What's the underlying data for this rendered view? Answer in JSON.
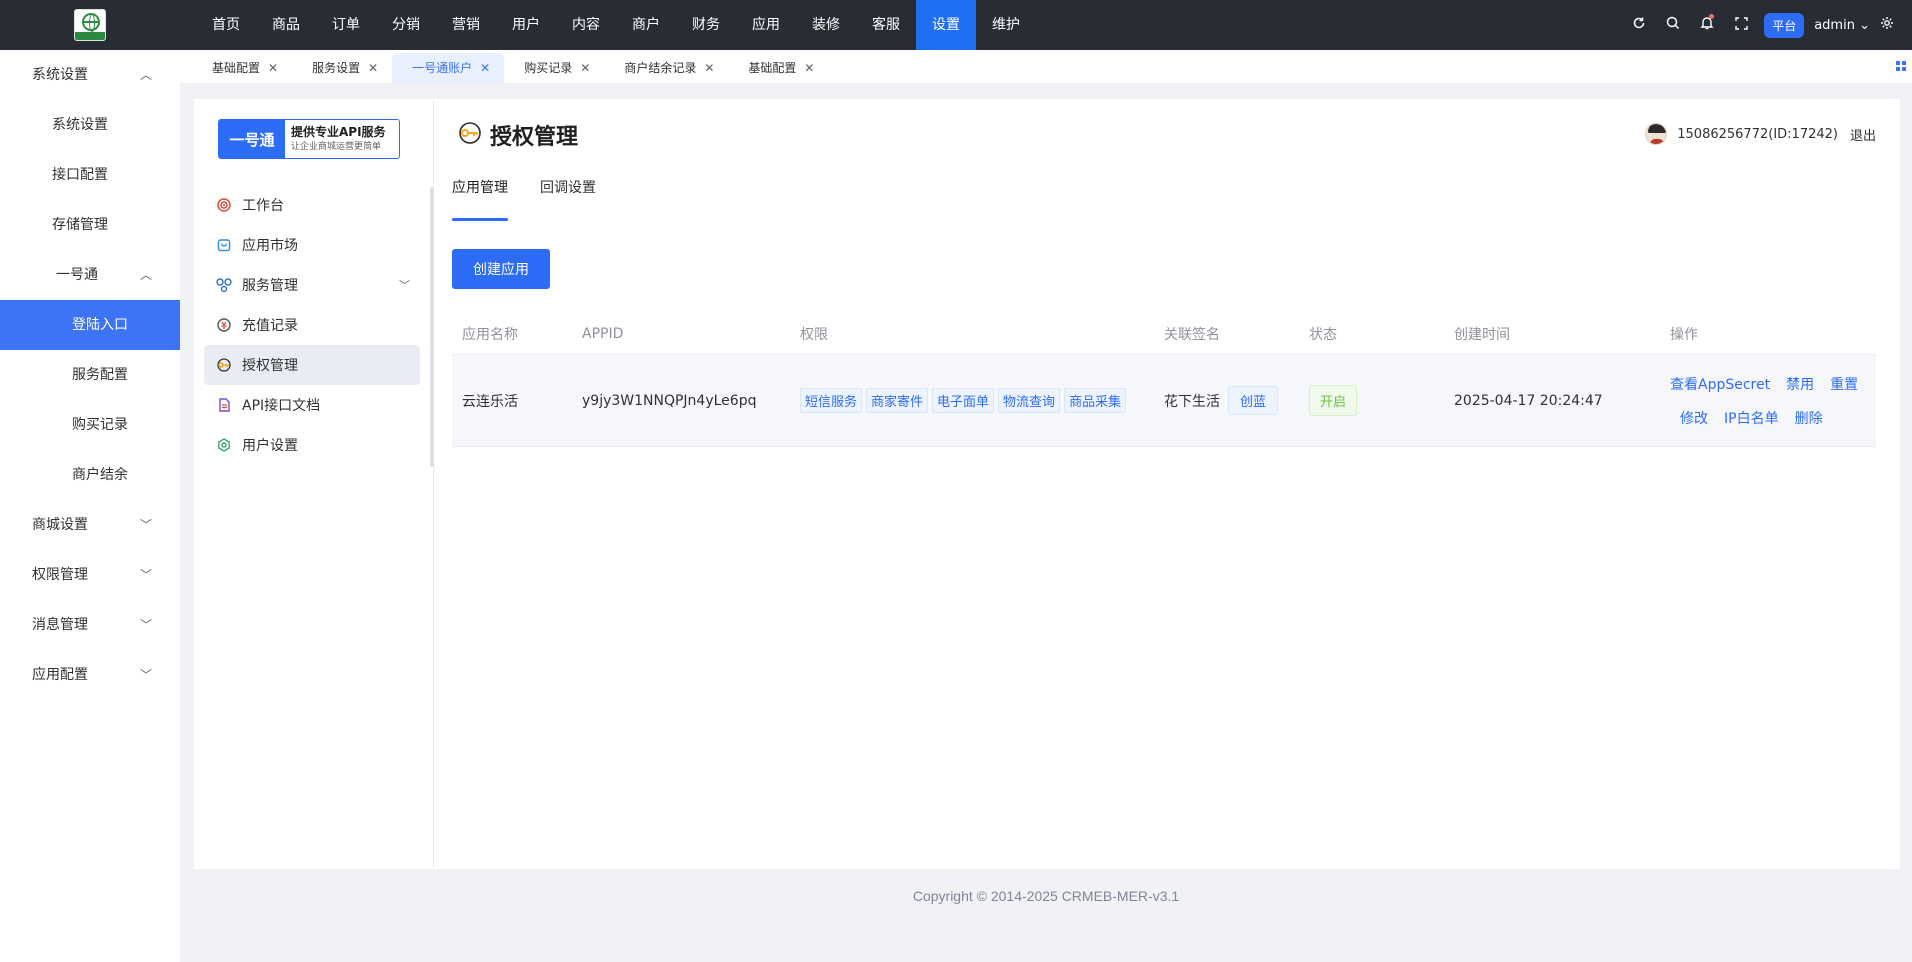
{
  "topbar": {
    "nav": [
      "首页",
      "商品",
      "订单",
      "分销",
      "营销",
      "用户",
      "内容",
      "商户",
      "财务",
      "应用",
      "装修",
      "客服",
      "设置",
      "维护"
    ],
    "active_index": 12,
    "platform_label": "平台",
    "admin_label": "admin"
  },
  "sidebar": {
    "items": [
      {
        "label": "系统设置",
        "arrow": "^"
      },
      {
        "label": "系统设置"
      },
      {
        "label": "接口配置"
      },
      {
        "label": "存储管理"
      },
      {
        "label": "一号通",
        "arrow": "^"
      },
      {
        "label": "登陆入口"
      },
      {
        "label": "服务配置"
      },
      {
        "label": "购买记录"
      },
      {
        "label": "商户结余"
      },
      {
        "label": "商城设置",
        "arrow": "v"
      },
      {
        "label": "权限管理",
        "arrow": "v"
      },
      {
        "label": "消息管理",
        "arrow": "v"
      },
      {
        "label": "应用配置",
        "arrow": "v"
      }
    ]
  },
  "tabs": [
    "基础配置",
    "服务设置",
    "一号通账户",
    "购买记录",
    "商户结余记录",
    "基础配置"
  ],
  "brand": {
    "left": "一号通",
    "title": "提供专业API服务",
    "subtitle": "让企业商城运营更简单"
  },
  "inner_menu": [
    "工作台",
    "应用市场",
    "服务管理",
    "充值记录",
    "授权管理",
    "API接口文档",
    "用户设置"
  ],
  "page": {
    "title": "授权管理",
    "user": "15086256772(ID:17242)",
    "logout": "退出",
    "subtabs": [
      "应用管理",
      "回调设置"
    ],
    "create_button": "创建应用"
  },
  "table": {
    "headers": [
      "应用名称",
      "APPID",
      "权限",
      "关联签名",
      "状态",
      "创建时间",
      "操作"
    ],
    "row": {
      "name": "云连乐活",
      "appid": "y9jy3W1NNQPJn4yLe6pq",
      "permissions": [
        "短信服务",
        "商家寄件",
        "电子面单",
        "物流查询",
        "商品采集"
      ],
      "sign_name": "花下生活",
      "sign_tag": "创蓝",
      "status": "开启",
      "created": "2025-04-17 20:24:47",
      "ops_row1": [
        "查看AppSecret",
        "禁用",
        "重置"
      ],
      "ops_row2": [
        "修改",
        "IP白名单",
        "删除"
      ]
    }
  },
  "footer": "Copyright © 2014-2025 CRMEB-MER-v3.1"
}
